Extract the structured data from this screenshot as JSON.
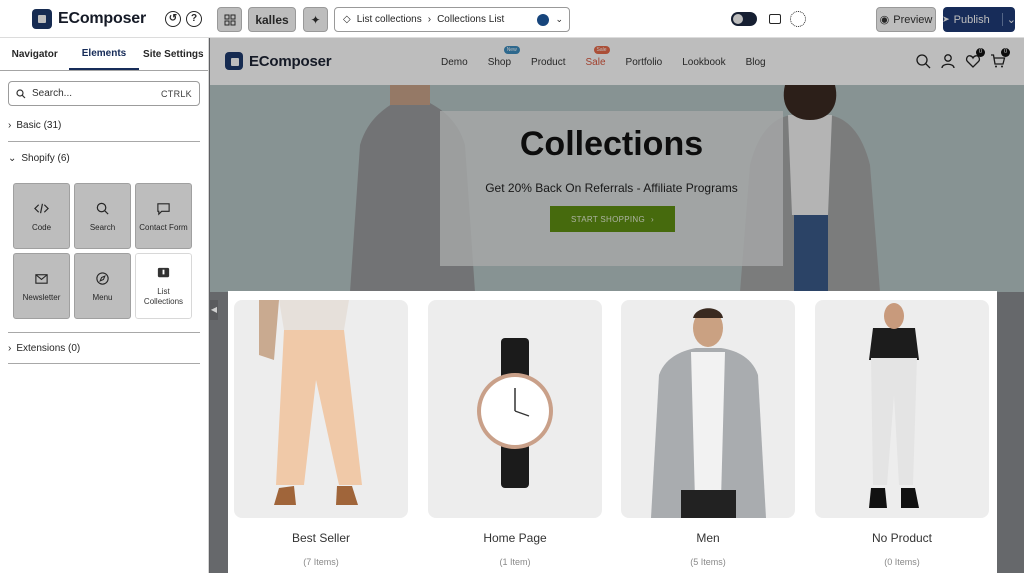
{
  "app": {
    "logo_text": "EComposer",
    "theme_badge": "kalles",
    "breadcrumb": {
      "parent": "List collections",
      "current": "Collections List"
    },
    "preview_label": "Preview",
    "publish_label": "Publish"
  },
  "panel": {
    "tabs": [
      "Navigator",
      "Elements",
      "Site Settings"
    ],
    "active_tab": "Elements",
    "search": {
      "placeholder": "Search...",
      "shortcut": "CTRLK"
    },
    "sections": [
      {
        "label": "Basic (31)",
        "expanded": false
      },
      {
        "label": "Shopify (6)",
        "expanded": true
      },
      {
        "label": "Extensions (0)",
        "expanded": false
      }
    ],
    "elements": [
      {
        "label": "Code",
        "icon": "code-icon"
      },
      {
        "label": "Search",
        "icon": "search-icon"
      },
      {
        "label": "Contact Form",
        "icon": "message-icon"
      },
      {
        "label": "Newsletter",
        "icon": "mail-icon"
      },
      {
        "label": "Menu",
        "icon": "compass-icon"
      },
      {
        "label": "List Collections",
        "icon": "collection-icon",
        "highlighted": true
      }
    ]
  },
  "site": {
    "logo_text": "EComposer",
    "nav": [
      {
        "label": "Demo"
      },
      {
        "label": "Shop",
        "badge": "New"
      },
      {
        "label": "Product"
      },
      {
        "label": "Sale",
        "badge": "Sale"
      },
      {
        "label": "Portfolio"
      },
      {
        "label": "Lookbook"
      },
      {
        "label": "Blog"
      }
    ],
    "wishlist_count": "0",
    "cart_count": "0",
    "hero": {
      "title": "Collections",
      "subtitle": "Get 20% Back On Referrals - Affiliate Programs",
      "button": "START SHOPPING"
    },
    "collections": [
      {
        "title": "Best Seller",
        "count": "(7 Items)",
        "image": "woman-beige-trousers"
      },
      {
        "title": "Home Page",
        "count": "(1 Item)",
        "image": "wrist-watch"
      },
      {
        "title": "Men",
        "count": "(5 Items)",
        "image": "man-grey-hoodie"
      },
      {
        "title": "No Product",
        "count": "(0 Items)",
        "image": "woman-white-jeans"
      }
    ]
  },
  "colors": {
    "brand": "#1f3c78",
    "hero_button": "#5e8f12",
    "sale": "#d9573d"
  }
}
